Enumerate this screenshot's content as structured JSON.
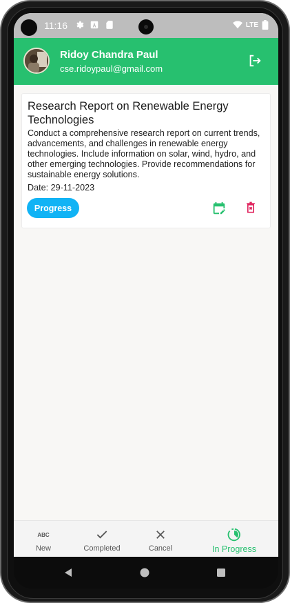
{
  "status_bar": {
    "time": "11:16",
    "network": "LTE",
    "icons_left": [
      "gear-icon",
      "text-icon",
      "sim-icon"
    ],
    "icons_right": [
      "wifi-icon",
      "signal-icon",
      "battery-icon"
    ]
  },
  "header": {
    "user_name": "Ridoy Chandra Paul",
    "user_email": "cse.ridoypaul@gmail.com",
    "logout_icon": "logout-icon",
    "accent_color": "#27c06f"
  },
  "tasks": [
    {
      "title": "Research Report on Renewable Energy Technologies",
      "description": "Conduct a comprehensive research report on current trends, advancements, and challenges in renewable energy technologies. Include information on solar, wind, hydro, and other emerging technologies. Provide recommendations for sustainable energy solutions.",
      "date": "Date: 29-11-2023",
      "status_label": "Progress",
      "status_color": "#11b3f5",
      "edit_icon": "calendar-edit-icon",
      "delete_icon": "delete-icon"
    }
  ],
  "bottom_nav": {
    "items": [
      {
        "label": "New",
        "icon": "abc-icon",
        "active": false
      },
      {
        "label": "Completed",
        "icon": "check-icon",
        "active": false
      },
      {
        "label": "Cancel",
        "icon": "close-icon",
        "active": false
      },
      {
        "label": "In Progress",
        "icon": "progress-icon",
        "active": true
      }
    ]
  },
  "system_nav": [
    "back-icon",
    "home-icon",
    "recents-icon"
  ]
}
